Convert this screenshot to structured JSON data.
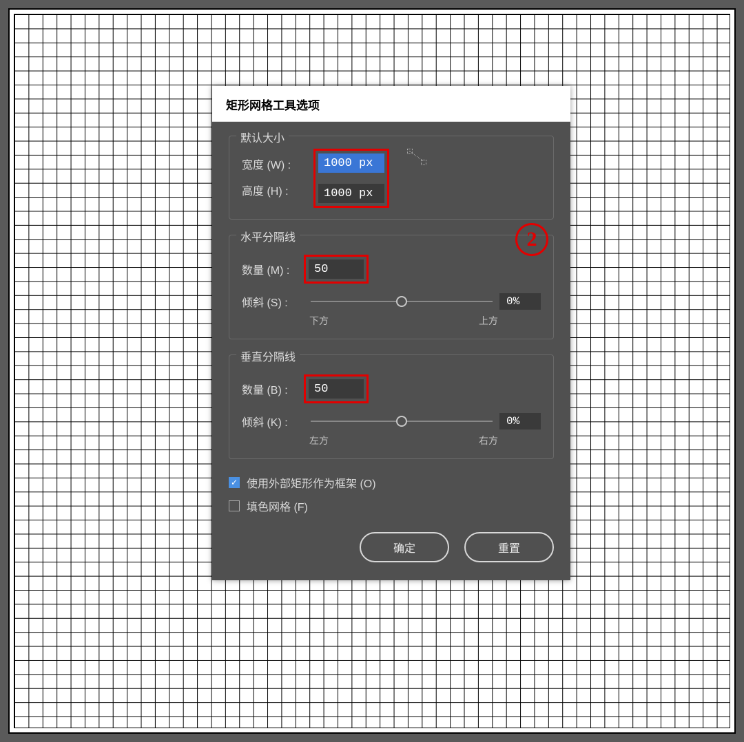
{
  "dialog": {
    "title": "矩形网格工具选项",
    "default_size": {
      "legend": "默认大小",
      "width_label": "宽度 (W) :",
      "width_value": "1000 px",
      "height_label": "高度 (H) :",
      "height_value": "1000 px"
    },
    "horizontal": {
      "legend": "水平分隔线",
      "count_label": "数量 (M) :",
      "count_value": "50",
      "skew_label": "倾斜 (S) :",
      "skew_value": "0%",
      "left_label": "下方",
      "right_label": "上方"
    },
    "vertical": {
      "legend": "垂直分隔线",
      "count_label": "数量 (B) :",
      "count_value": "50",
      "skew_label": "倾斜 (K) :",
      "skew_value": "0%",
      "left_label": "左方",
      "right_label": "右方"
    },
    "use_outer_rect": "使用外部矩形作为框架 (O)",
    "fill_grid": "填色网格 (F)",
    "ok": "确定",
    "reset": "重置"
  },
  "annotation": {
    "badge": "2"
  }
}
